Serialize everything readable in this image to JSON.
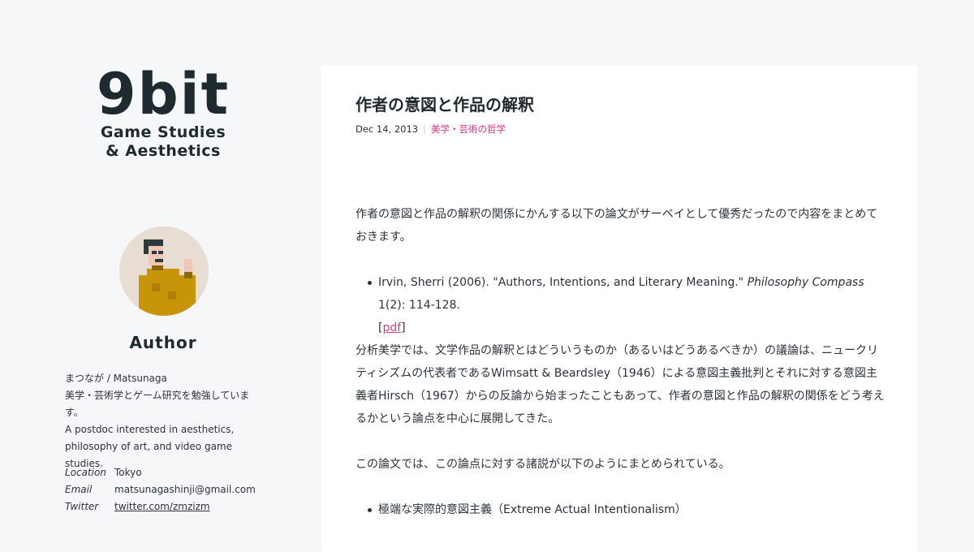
{
  "sidebar": {
    "logo_mark": "9bit",
    "logo_line1": "Game Studies",
    "logo_line2": "& Aesthetics",
    "author_heading": "Author",
    "bio_name": "まつなが / Matsunaga",
    "bio_ja": "美学・芸術学とゲーム研究を勉強しています。",
    "bio_en": "A postdoc interested in aesthetics, philosophy of art, and video game studies.",
    "meta": [
      {
        "key": "Location",
        "value": "Tokyo"
      },
      {
        "key": "Email",
        "value": "matsunagashinji@gmail.com"
      },
      {
        "key": "Twitter",
        "value": "twitter.com/zmzizm"
      }
    ]
  },
  "post": {
    "title": "作者の意図と作品の解釈",
    "date": "Dec 14, 2013",
    "category": "美学・芸術の哲学",
    "para1": "作者の意図と作品の解釈の関係にかんする以下の論文がサーベイとして優秀だったので内容をまとめておきます。",
    "ref_author": "Irvin, Sherri (2006). \"Authors, Intentions, and Literary Meaning.\" ",
    "ref_journal": "Philosophy Compass",
    "ref_tail": " 1(2): 114-128.",
    "ref_open": "[",
    "ref_link": "pdf",
    "ref_close": "]",
    "para2": "分析美学では、文学作品の解釈とはどういうものか（あるいはどうあるべきか）の議論は、ニュークリティシズムの代表者であるWimsatt & Beardsley（1946）による意図主義批判とそれに対する意図主義者Hirsch（1967）からの反論から始まったこともあって、作者の意図と作品の解釈の関係をどう考えるかという論点を中心に展開してきた。",
    "para3": "この論文では、この論点に対する諸説が以下のようにまとめられている。",
    "list2_item1": "極端な実際的意図主義（Extreme Actual Intentionalism）"
  },
  "colors": {
    "accent": "#d6397b",
    "background": "#f5f7f8",
    "card": "#ffffff",
    "text": "#2c3238"
  }
}
